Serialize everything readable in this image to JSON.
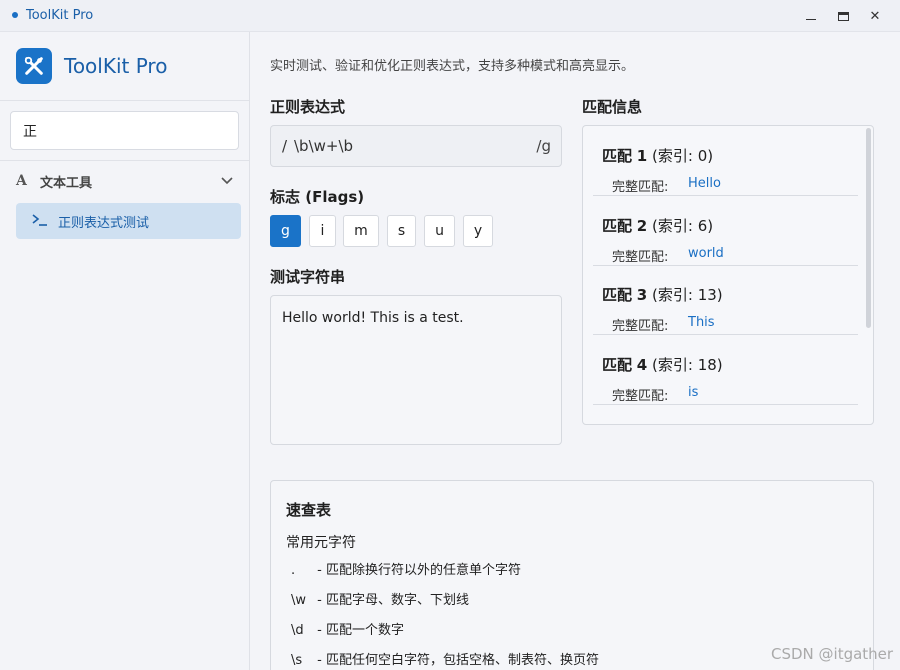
{
  "window": {
    "title": "ToolKit Pro"
  },
  "sidebar": {
    "brand": "ToolKit Pro",
    "search": {
      "value": "正",
      "placeholder": ""
    },
    "group": {
      "label": "文本工具",
      "icon": "font-a-icon"
    },
    "items": [
      {
        "label": "正则表达式测试",
        "icon": "terminal-icon",
        "active": true
      }
    ]
  },
  "main": {
    "description": "实时测试、验证和优化正则表达式，支持多种模式和高亮显示。",
    "regex": {
      "title": "正则表达式",
      "prefix": "/",
      "pattern": "\\b\\w+\\b",
      "suffix": "/g"
    },
    "flags": {
      "title": "标志 (Flags)",
      "items": [
        {
          "label": "g",
          "active": true
        },
        {
          "label": "i",
          "active": false
        },
        {
          "label": "m",
          "active": false
        },
        {
          "label": "s",
          "active": false
        },
        {
          "label": "u",
          "active": false
        },
        {
          "label": "y",
          "active": false
        }
      ]
    },
    "test": {
      "title": "测试字符串",
      "value": "Hello world! This is a test."
    },
    "matches": {
      "title": "匹配信息",
      "full_label": "完整匹配:",
      "items": [
        {
          "prefix": "匹配",
          "num": "1",
          "index": "(索引: 0)",
          "value": "Hello"
        },
        {
          "prefix": "匹配",
          "num": "2",
          "index": "(索引: 6)",
          "value": "world"
        },
        {
          "prefix": "匹配",
          "num": "3",
          "index": "(索引: 13)",
          "value": "This"
        },
        {
          "prefix": "匹配",
          "num": "4",
          "index": "(索引: 18)",
          "value": "is"
        }
      ]
    },
    "cheatsheet": {
      "title": "速查表",
      "subtitle": "常用元字符",
      "rows": [
        {
          "token": ".",
          "desc": "- 匹配除换行符以外的任意单个字符"
        },
        {
          "token": "\\w",
          "desc": "- 匹配字母、数字、下划线"
        },
        {
          "token": "\\d",
          "desc": "- 匹配一个数字"
        },
        {
          "token": "\\s",
          "desc": "- 匹配任何空白字符，包括空格、制表符、换页符"
        }
      ]
    }
  },
  "watermark": "CSDN @itgather",
  "colors": {
    "accent": "#1a73c8",
    "nav_active_bg": "#cfe0f1",
    "link": "#1a6fc4"
  }
}
